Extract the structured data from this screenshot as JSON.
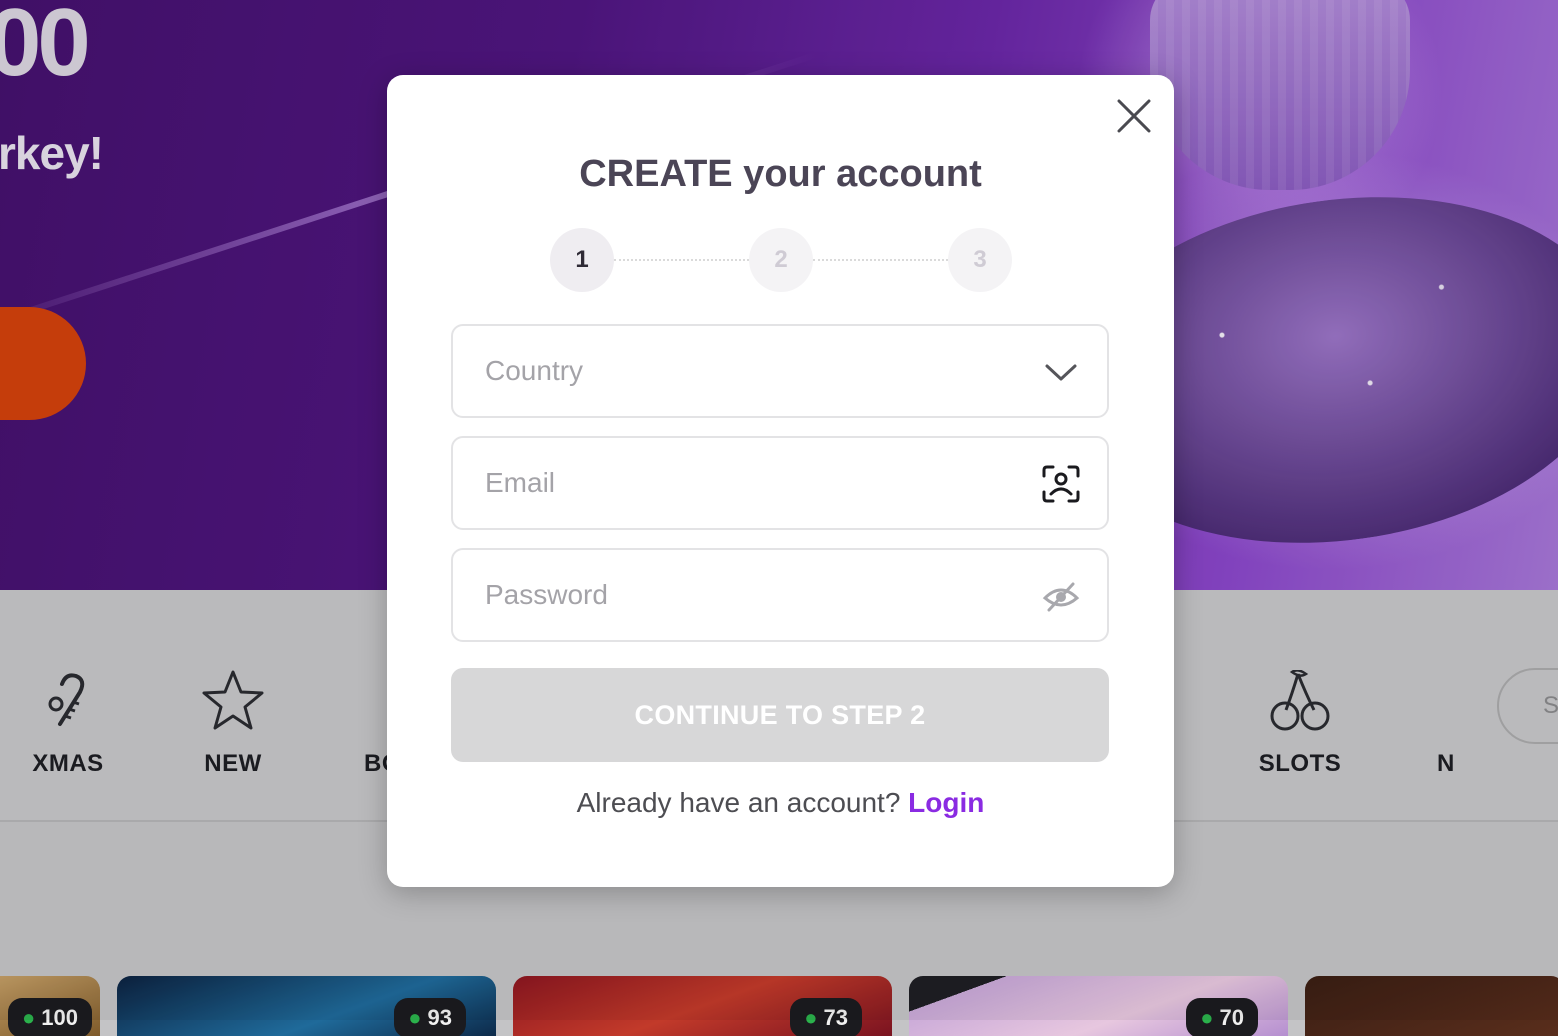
{
  "hero": {
    "amount_fragment": "00",
    "subtitle_fragment": "rkey!"
  },
  "categories": [
    {
      "label": "XMAS",
      "icon": "candy-cane-icon"
    },
    {
      "label": "NEW",
      "icon": "star-icon"
    },
    {
      "label": "BO",
      "icon": ""
    },
    {
      "label": "SLOTS",
      "icon": "cherries-icon"
    },
    {
      "label": "N",
      "icon": ""
    }
  ],
  "category_search_fragment": "S",
  "game_cards": [
    {
      "badge": "100"
    },
    {
      "badge": "93"
    },
    {
      "badge": "73"
    },
    {
      "badge": "70"
    },
    {
      "badge": ""
    }
  ],
  "modal": {
    "title": "CREATE your account",
    "steps": [
      "1",
      "2",
      "3"
    ],
    "active_step": 1,
    "country": {
      "placeholder": "Country"
    },
    "email": {
      "placeholder": "Email"
    },
    "password": {
      "placeholder": "Password"
    },
    "continue_label": "CONTINUE TO STEP 2",
    "login_prompt": "Already have an account?",
    "login_link": "Login"
  },
  "colors": {
    "accent_link": "#8a2be2",
    "title": "#4b4556",
    "cta_disabled": "#d7d7d8",
    "hero_purple": "#4f1680"
  }
}
